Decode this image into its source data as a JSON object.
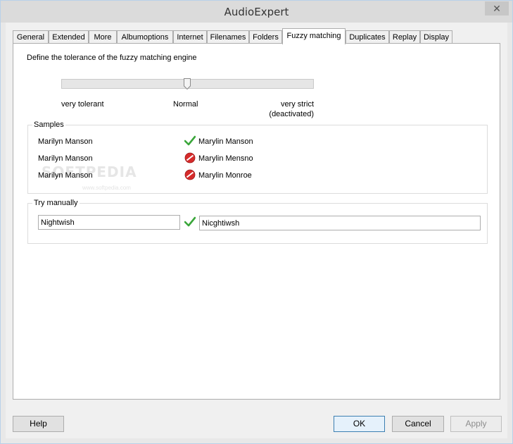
{
  "window": {
    "title": "AudioExpert",
    "close_glyph": "✕"
  },
  "tabs": [
    {
      "label": "General"
    },
    {
      "label": "Extended"
    },
    {
      "label": "More"
    },
    {
      "label": "Albumoptions"
    },
    {
      "label": "Internet"
    },
    {
      "label": "Filenames"
    },
    {
      "label": "Folders"
    },
    {
      "label": "Fuzzy matching",
      "active": true
    },
    {
      "label": "Duplicates"
    },
    {
      "label": "Replay"
    },
    {
      "label": "Display"
    }
  ],
  "tolerance": {
    "description": "Define the tolerance of the fuzzy matching engine",
    "slider_value": 0.5,
    "label_left": "very tolerant",
    "label_center": "Normal",
    "label_right_1": "very strict",
    "label_right_2": "(deactivated)"
  },
  "samples": {
    "title": "Samples",
    "rows": [
      {
        "input": "Marilyn Manson",
        "match": true,
        "result": "Marylin Manson"
      },
      {
        "input": "Marilyn Manson",
        "match": false,
        "result": "Marylin Mensno"
      },
      {
        "input": "Marilyn Manson",
        "match": false,
        "result": "Marylin Monroe"
      }
    ]
  },
  "manual": {
    "title": "Try manually",
    "left_value": "Nightwish",
    "right_value": "Nicghtiwsh",
    "match": true
  },
  "watermark": {
    "text": "SOFTPEDIA",
    "sub": "www.softpedia.com"
  },
  "buttons": {
    "help": "Help",
    "ok": "OK",
    "cancel": "Cancel",
    "apply": "Apply"
  },
  "colors": {
    "match_green": "#3aa63a",
    "nomatch_red": "#d62b2b"
  }
}
